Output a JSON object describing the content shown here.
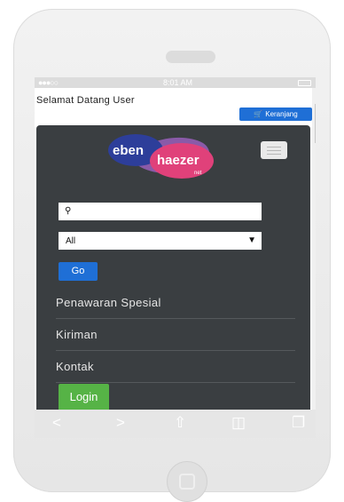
{
  "status": {
    "time": "8:01 AM"
  },
  "header": {
    "welcome": "Selamat Datang User",
    "cart_label": "Keranjang"
  },
  "brand": {
    "word1": "eben",
    "word2": "haezer",
    "suffix": "net",
    "colors": {
      "blue": "#2d3e9a",
      "pink": "#e0417a",
      "purple": "#7b55a8"
    }
  },
  "search": {
    "value": "",
    "placeholder": ""
  },
  "category_select": {
    "selected": "All"
  },
  "go_label": "Go",
  "menu": [
    {
      "label": "Penawaran Spesial"
    },
    {
      "label": "Kiriman"
    },
    {
      "label": "Kontak"
    }
  ],
  "login_label": "Login",
  "colors": {
    "accent": "#1f6fd6",
    "nav_bg": "#3a3e41",
    "login": "#56b346"
  },
  "icons": [
    "search-icon",
    "cart-icon",
    "menu-icon",
    "chevron-down-icon",
    "back-icon",
    "forward-icon",
    "share-icon",
    "bookmarks-icon",
    "tabs-icon"
  ]
}
